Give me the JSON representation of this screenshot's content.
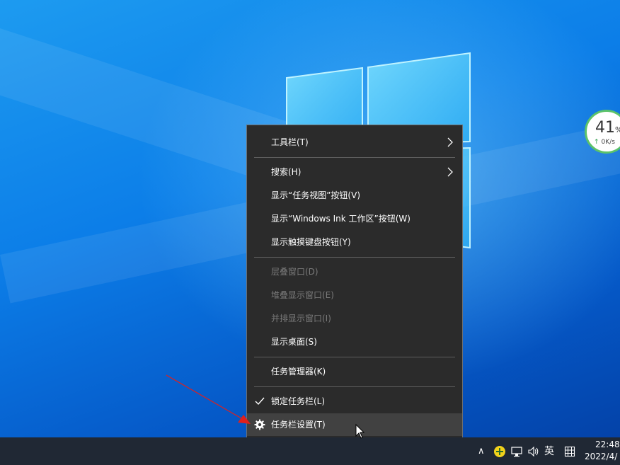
{
  "desktop": {
    "net_widget": {
      "percent": "41",
      "percent_sign": "%",
      "speed": "0K/s",
      "up_arrow": "↑"
    }
  },
  "context_menu": {
    "items": [
      {
        "label": "工具栏(T)",
        "enabled": true,
        "submenu": true
      },
      {
        "label": "搜索(H)",
        "enabled": true,
        "submenu": true
      },
      {
        "label": "显示“任务视图”按钮(V)",
        "enabled": true
      },
      {
        "label": "显示“Windows Ink 工作区”按钮(W)",
        "enabled": true
      },
      {
        "label": "显示触摸键盘按钮(Y)",
        "enabled": true
      },
      {
        "label": "层叠窗口(D)",
        "enabled": false
      },
      {
        "label": "堆叠显示窗口(E)",
        "enabled": false
      },
      {
        "label": "并排显示窗口(I)",
        "enabled": false
      },
      {
        "label": "显示桌面(S)",
        "enabled": true
      },
      {
        "label": "任务管理器(K)",
        "enabled": true
      },
      {
        "label": "锁定任务栏(L)",
        "enabled": true,
        "checked": true
      },
      {
        "label": "任务栏设置(T)",
        "enabled": true,
        "icon": "gear-icon",
        "hovered": true
      }
    ]
  },
  "taskbar": {
    "tray": {
      "chevron": "∧",
      "ime_label": "英",
      "clock_time": "22:48",
      "clock_date": "2022/4/"
    }
  },
  "colors": {
    "menu_bg": "#2b2b2b",
    "menu_hover": "#414141",
    "disabled_text": "#7a7a7a",
    "taskbar_bg": "#202834",
    "annotation_arrow": "#e0201c"
  }
}
